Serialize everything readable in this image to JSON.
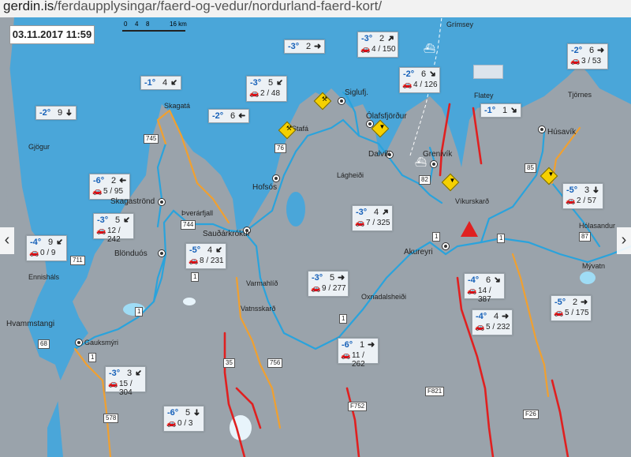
{
  "browser": {
    "url_domain": "gerdin.is",
    "url_path": "/ferdaupplysingar/faerd-og-vedur/nordurland-faerd-kort/"
  },
  "map": {
    "timestamp": "03.11.2017  11:59",
    "scale": {
      "ticks": [
        "0",
        "4",
        "8"
      ],
      "unit": "16 km"
    },
    "stations": [
      {
        "temp": "-3°",
        "wind": "2",
        "arrow": "➜",
        "cars": "4 / 150"
      },
      {
        "temp": "-2°",
        "wind": "6",
        "arrow": "➜",
        "cars": "3 / 53"
      },
      {
        "temp": "-1°",
        "wind": "4",
        "arrow": "➜",
        "cars": ""
      },
      {
        "temp": "-3°",
        "wind": "5",
        "arrow": "➜",
        "cars": "2 / 48"
      },
      {
        "temp": "-3°",
        "wind": "2",
        "arrow": "➜",
        "cars": ""
      },
      {
        "temp": "-2°",
        "wind": "6",
        "arrow": "➜",
        "cars": "4 / 126"
      },
      {
        "temp": "-2°",
        "wind": "9",
        "arrow": "➜",
        "cars": ""
      },
      {
        "temp": "-2°",
        "wind": "6",
        "arrow": "➜",
        "cars": ""
      },
      {
        "temp": "-1°",
        "wind": "1",
        "arrow": "➜",
        "cars": ""
      },
      {
        "temp": "-6°",
        "wind": "2",
        "arrow": "➜",
        "cars": "5 / 95"
      },
      {
        "temp": "-5°",
        "wind": "3",
        "arrow": "➜",
        "cars": "2 / 57"
      },
      {
        "temp": "-3°",
        "wind": "5",
        "arrow": "➜",
        "cars": "12 / 242"
      },
      {
        "temp": "-3°",
        "wind": "4",
        "arrow": "➜",
        "cars": "7 / 325"
      },
      {
        "temp": "-4°",
        "wind": "9",
        "arrow": "➜",
        "cars": "0 / 9"
      },
      {
        "temp": "-5°",
        "wind": "4",
        "arrow": "➜",
        "cars": "8 / 231"
      },
      {
        "temp": "-3°",
        "wind": "5",
        "arrow": "➜",
        "cars": "9 / 277"
      },
      {
        "temp": "-4°",
        "wind": "6",
        "arrow": "➜",
        "cars": "14 / 387"
      },
      {
        "temp": "-5°",
        "wind": "2",
        "arrow": "➜",
        "cars": "5 / 175"
      },
      {
        "temp": "-4°",
        "wind": "4",
        "arrow": "➜",
        "cars": "5 / 232"
      },
      {
        "temp": "-6°",
        "wind": "1",
        "arrow": "➜",
        "cars": "11 / 262"
      },
      {
        "temp": "-3°",
        "wind": "3",
        "arrow": "➜",
        "cars": "15 / 304"
      },
      {
        "temp": "-6°",
        "wind": "5",
        "arrow": "➜",
        "cars": "0 / 3"
      }
    ],
    "places": [
      "Grímsey",
      "Siglufj.",
      "Ólafsfjörður",
      "Flatey",
      "Tjörnes",
      "Skagatá",
      "Stafá",
      "Húsavík",
      "Gjögur",
      "Dalvík",
      "Grenivík",
      "Lágheiði",
      "Hofsós",
      "Skagaströnd",
      "Þverárfjall",
      "Víkurskarð",
      "Hólasandur",
      "Sauðárkrókur",
      "Blönduós",
      "Ennisháls",
      "Akureyri",
      "Mývatn",
      "Varmahlíð",
      "Vatnsskarð",
      "Oxnadalsheiði",
      "Hvammstangi",
      "Gauksmýri"
    ],
    "roads": [
      "745",
      "76",
      "82",
      "85",
      "744",
      "711",
      "87",
      "1",
      "1",
      "1",
      "1",
      "1",
      "68",
      "1",
      "35",
      "756",
      "F821",
      "578",
      "F752",
      "F26"
    ],
    "colors": {
      "sea": "#4aa6d9",
      "land": "#9aa3ab",
      "good_road": "#2aa3dc",
      "slippery_road": "#f0a030",
      "closed_road": "#e02020",
      "temp": "#1560b8"
    },
    "icons": [
      "car-icon",
      "warning-icon",
      "snowplow-icon",
      "ferry-icon",
      "town-icon"
    ]
  }
}
